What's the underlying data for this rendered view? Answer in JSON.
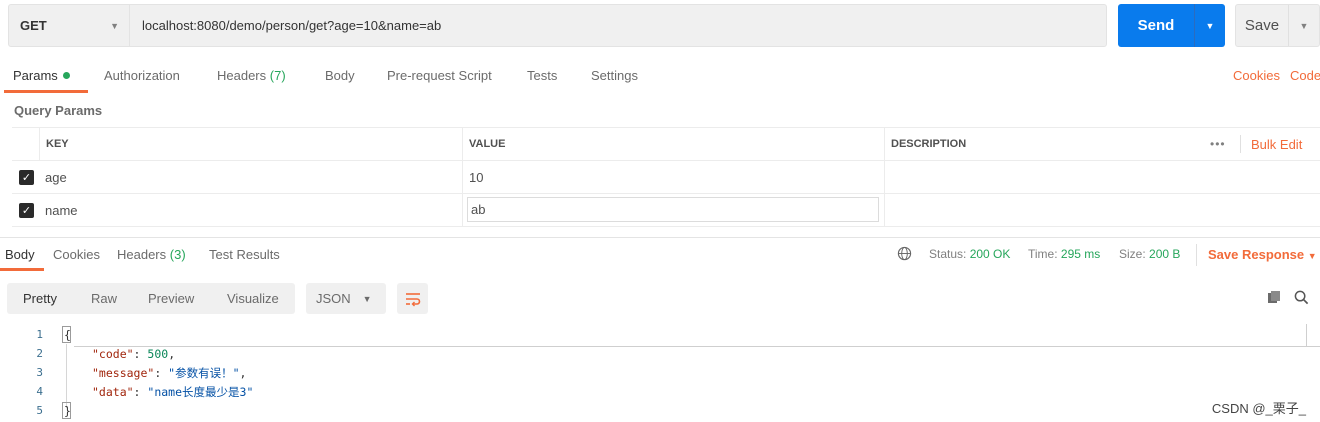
{
  "request": {
    "method": "GET",
    "url": "localhost:8080/demo/person/get?age=10&name=ab",
    "send_label": "Send",
    "save_label": "Save"
  },
  "request_tabs": {
    "params": "Params",
    "authorization": "Authorization",
    "headers": "Headers",
    "headers_count": "(7)",
    "body": "Body",
    "prerequest": "Pre-request Script",
    "tests": "Tests",
    "settings": "Settings",
    "cookies": "Cookies",
    "code": "Code"
  },
  "query_params": {
    "title": "Query Params",
    "columns": [
      "KEY",
      "VALUE",
      "DESCRIPTION"
    ],
    "more": "•••",
    "bulk_edit": "Bulk Edit",
    "rows": [
      {
        "key": "age",
        "value": "10",
        "description": "",
        "checked": true
      },
      {
        "key": "name",
        "value": "ab",
        "description": "",
        "checked": true
      }
    ]
  },
  "response_tabs": {
    "body": "Body",
    "cookies": "Cookies",
    "headers": "Headers",
    "headers_count": "(3)",
    "test_results": "Test Results"
  },
  "response_status": {
    "status_label": "Status:",
    "status_value": "200 OK",
    "time_label": "Time:",
    "time_value": "295 ms",
    "size_label": "Size:",
    "size_value": "200 B",
    "save_response": "Save Response"
  },
  "format": {
    "modes": [
      "Pretty",
      "Raw",
      "Preview",
      "Visualize"
    ],
    "active": "Pretty",
    "language": "JSON"
  },
  "code_lines": {
    "numbers": [
      "1",
      "2",
      "3",
      "4",
      "5"
    ],
    "open": "{",
    "close": "}",
    "code_key": "\"code\"",
    "code_value": "500",
    "message_key": "\"message\"",
    "message_value": "\"参数有误！\"",
    "data_key": "\"data\"",
    "data_value": "\"name长度最少是3\""
  },
  "watermark": "CSDN @_栗子_",
  "colors": {
    "accent": "#f26b3a",
    "send": "#097bed",
    "success": "#26a65b"
  }
}
